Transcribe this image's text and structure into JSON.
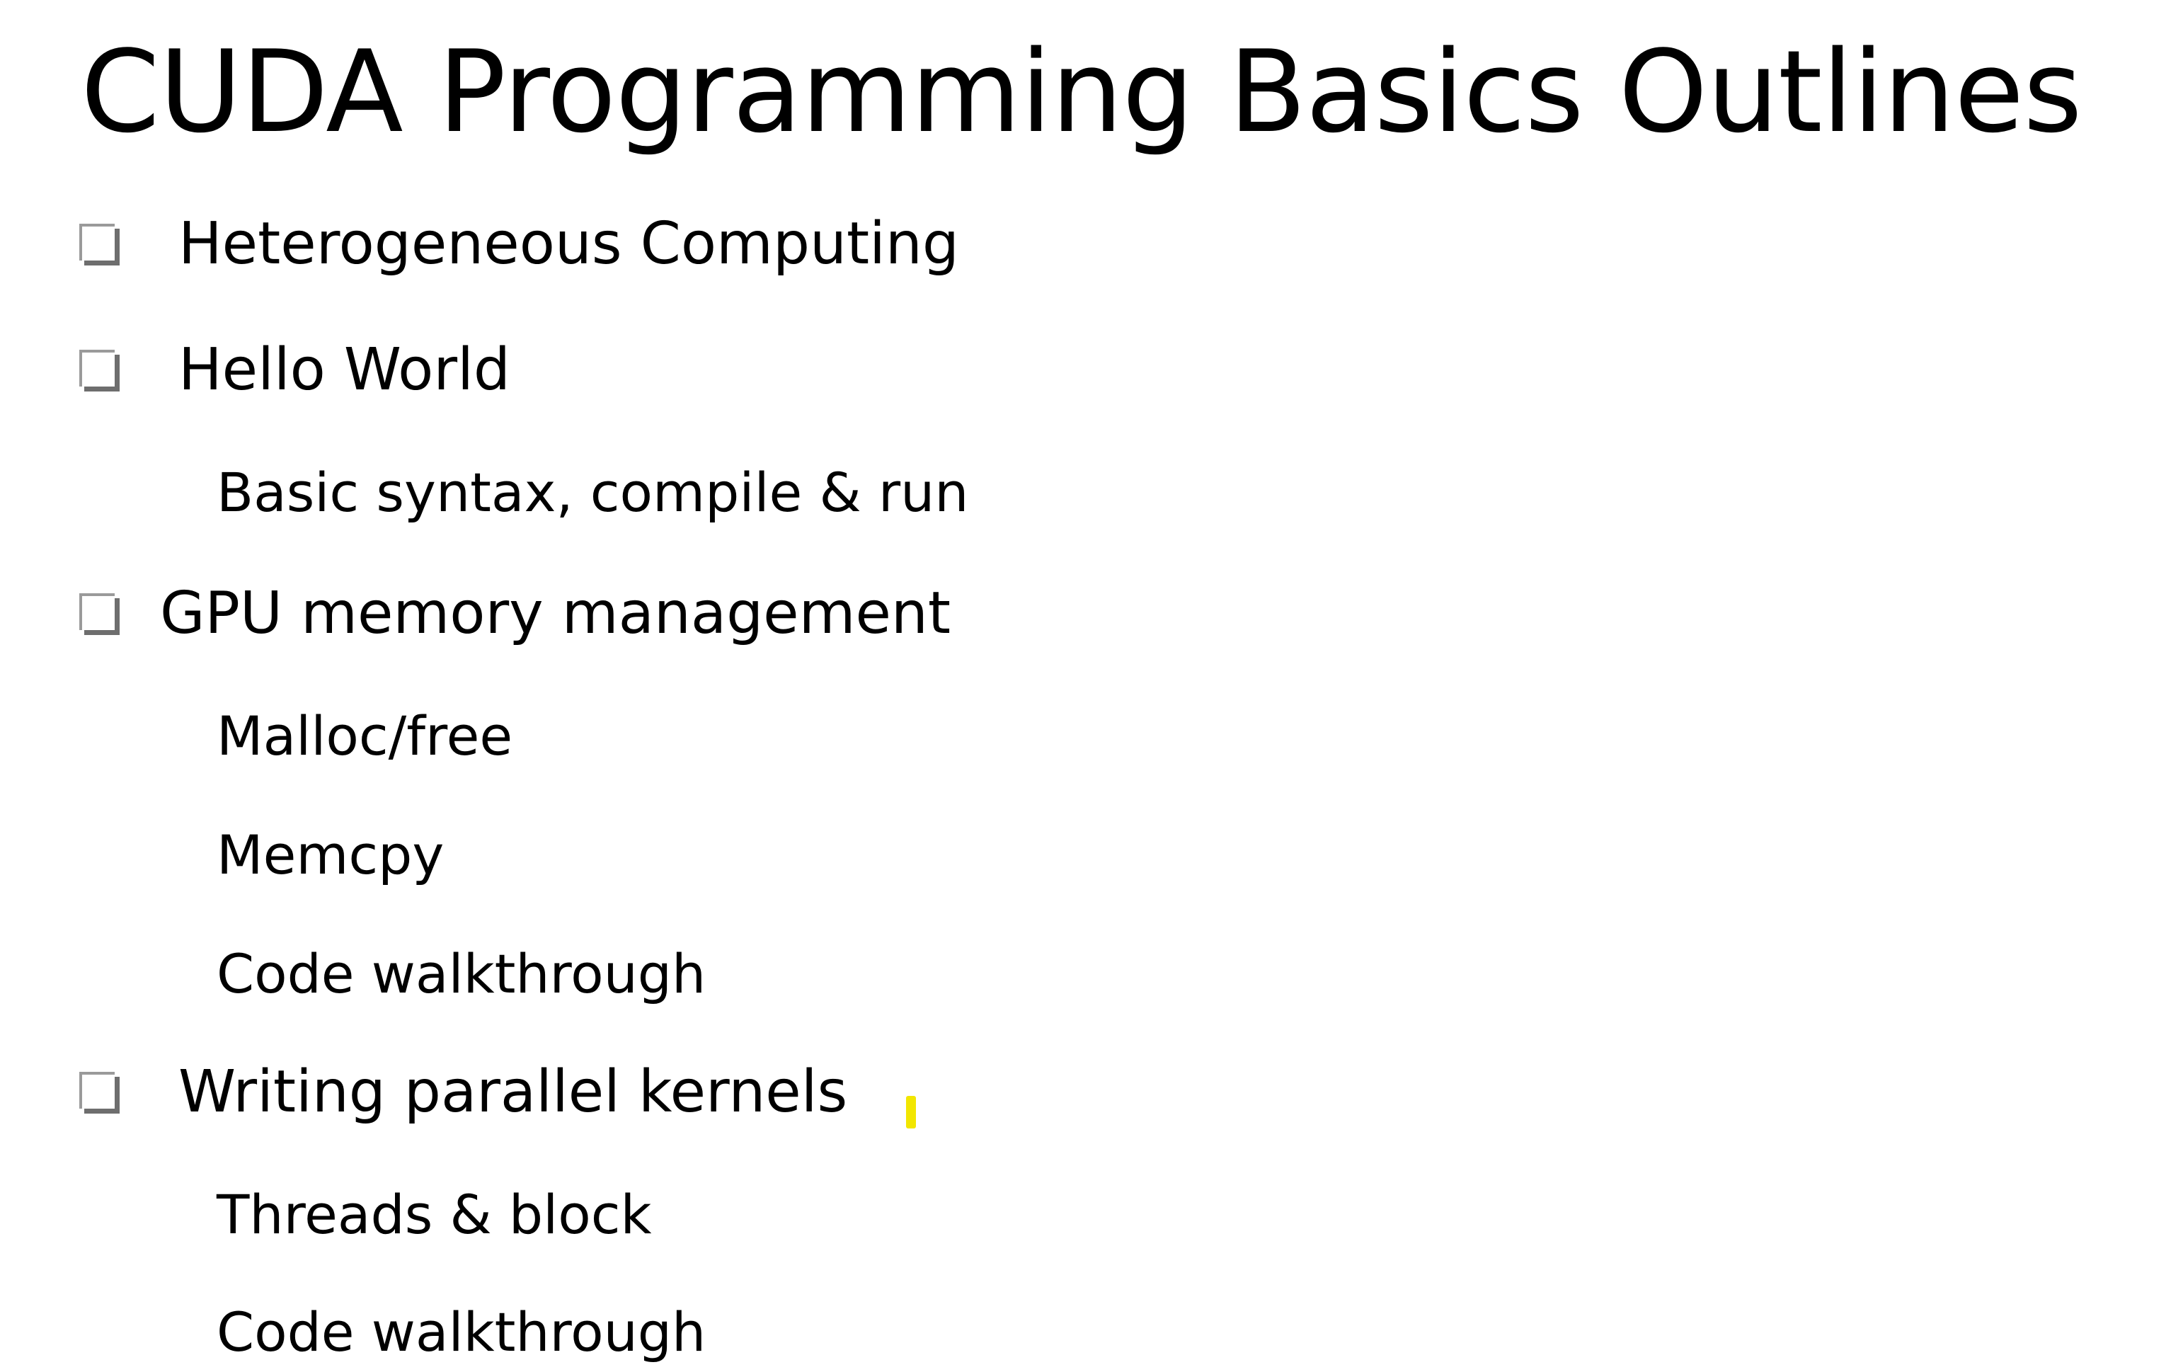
{
  "slide": {
    "title": "CUDA Programming Basics Outlines",
    "outline": [
      {
        "label": "Heterogeneous Computing",
        "subitems": []
      },
      {
        "label": "Hello World",
        "subitems": [
          "Basic syntax, compile & run"
        ]
      },
      {
        "label": "GPU memory management",
        "subitems": [
          "Malloc/free",
          "Memcpy",
          "Code walkthrough"
        ]
      },
      {
        "label": "Writing parallel kernels",
        "subitems": [
          "Threads & block",
          "Code walkthrough"
        ]
      }
    ],
    "bullet_icon": "checkbox-icon",
    "colors": {
      "background": "#ffffff",
      "text": "#000000",
      "bullet_border": "#9a9a9a",
      "bullet_shadow": "#6e6e6e",
      "pointer_mark": "#f2e600"
    }
  }
}
